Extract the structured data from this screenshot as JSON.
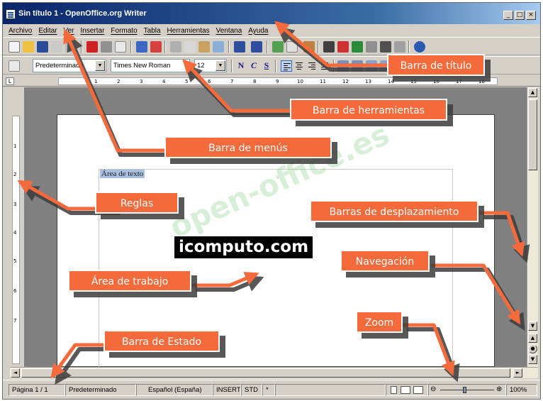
{
  "window": {
    "title": "Sin título 1 - OpenOffice.org Writer",
    "buttons": [
      "_",
      "□",
      "×"
    ]
  },
  "menubar": {
    "items": [
      "Archivo",
      "Editar",
      "Ver",
      "Insertar",
      "Formato",
      "Tabla",
      "Herramientas",
      "Ventana",
      "Ayuda"
    ]
  },
  "toolbar2": {
    "style_value": "Predeterminado",
    "font_value": "Times New Roman",
    "size_value": "12",
    "bold_label": "N",
    "italic_label": "C",
    "underline_label": "S"
  },
  "ruler": {
    "numbers": [
      "1",
      "2",
      "3",
      "4",
      "5",
      "6",
      "7",
      "8",
      "9",
      "10",
      "11",
      "12",
      "13",
      "14",
      "15",
      "16",
      "17",
      "18"
    ],
    "vertical_numbers": [
      "1",
      "2",
      "3",
      "4",
      "5",
      "6",
      "7"
    ],
    "corner_glyph": "L"
  },
  "document": {
    "text_area_label": "Área de texto"
  },
  "statusbar": {
    "page": "Página  1 / 1",
    "style": "Predeterminado",
    "language": "Español (España)",
    "insert_mode": "INSERT",
    "selection_mode": "STD",
    "modified": "*",
    "zoom": "100%"
  },
  "callouts": {
    "titlebar": "Barra de título",
    "toolbars": "Barra de herramientas",
    "menubar": "Barra de menús",
    "rulers": "Reglas",
    "scrollbars": "Barras de desplazamiento",
    "navigation": "Navegación",
    "workspace": "Área de trabajo",
    "zoom": "Zoom",
    "statusbar": "Barra de Estado"
  },
  "branding": {
    "watermark": "open-office.es",
    "site": "icomputo.com"
  },
  "colors": {
    "callout": "#f46a3a",
    "titlebar": "#0a246a",
    "workspace": "#808080"
  }
}
